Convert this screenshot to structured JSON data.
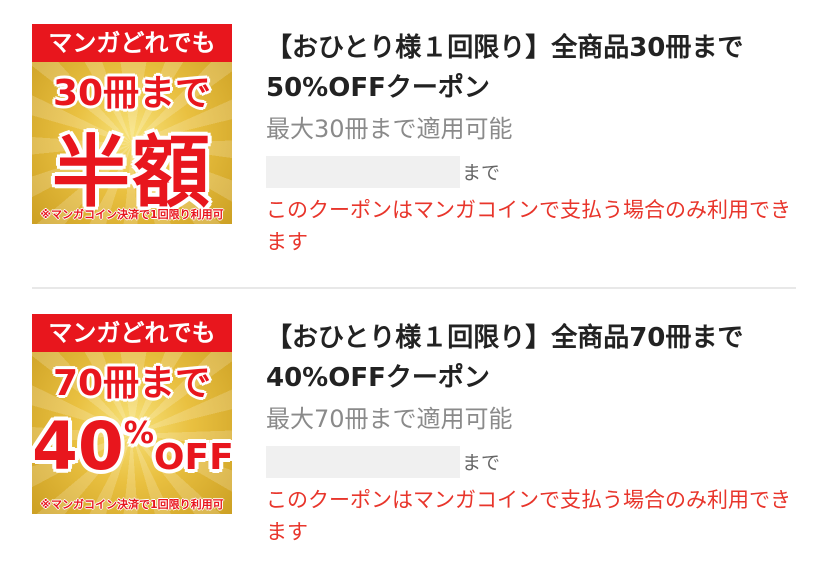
{
  "coupons": [
    {
      "banner": {
        "top_text": "マンガどれでも",
        "line2": "30冊まで",
        "main": "半額",
        "note": "※マンガコイン決済で1回限り利用可"
      },
      "title": "【おひとり様１回限り】全商品30冊まで50%OFFクーポン",
      "limit": "最大30冊まで適用可能",
      "date_suffix": "まで",
      "notice": "このクーポンはマンガコインで支払う場合のみ利用できます"
    },
    {
      "banner": {
        "top_text": "マンガどれでも",
        "line2": "70冊まで",
        "main_number": "40",
        "main_percent": "%",
        "main_off": "OFF",
        "note": "※マンガコイン決済で1回限り利用可"
      },
      "title": "【おひとり様１回限り】全商品70冊まで40%OFFクーポン",
      "limit": "最大70冊まで適用可能",
      "date_suffix": "まで",
      "notice": "このクーポンはマンガコインで支払う場合のみ利用できます"
    }
  ],
  "colors": {
    "accent_red": "#e8161d",
    "notice_red": "#e8352b",
    "gold": "#e9c040"
  }
}
